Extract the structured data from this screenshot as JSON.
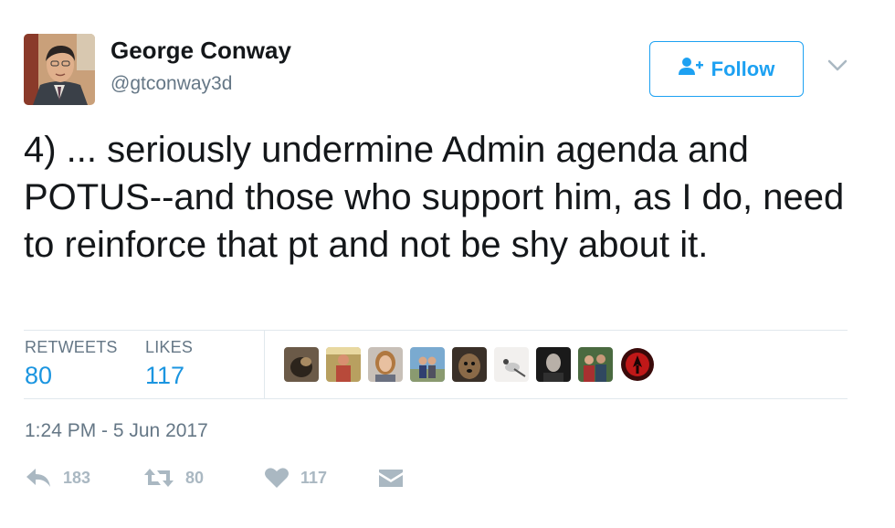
{
  "user": {
    "name": "George Conway",
    "handle": "@gtconway3d",
    "avatar_icon": "user-avatar-portrait"
  },
  "follow_button": {
    "label": "Follow",
    "icon": "follow-person-plus-icon",
    "color": "#1da1f2"
  },
  "menu": {
    "icon": "chevron-down-icon"
  },
  "tweet": {
    "text": "4) ... seriously undermine Admin agenda and POTUS--and those who support him, as I do, need to reinforce that pt and not be shy about it.",
    "timestamp": "1:24 PM - 5 Jun 2017"
  },
  "stats": {
    "retweets_label": "RETWEETS",
    "retweets_value": "80",
    "likes_label": "LIKES",
    "likes_value": "117",
    "accent_color": "#1b95e0"
  },
  "liker_avatars": [
    {
      "icon": "liker-avatar-dog"
    },
    {
      "icon": "liker-avatar-group"
    },
    {
      "icon": "liker-avatar-woman"
    },
    {
      "icon": "liker-avatar-couple"
    },
    {
      "icon": "liker-avatar-dog-portrait"
    },
    {
      "icon": "liker-avatar-bird"
    },
    {
      "icon": "liker-avatar-man-dark"
    },
    {
      "icon": "liker-avatar-family"
    },
    {
      "icon": "liker-avatar-red-logo"
    }
  ],
  "actions": {
    "reply": {
      "icon": "reply-icon",
      "count": "183"
    },
    "retweet": {
      "icon": "retweet-icon",
      "count": "80"
    },
    "like": {
      "icon": "heart-icon",
      "count": "117"
    },
    "message": {
      "icon": "direct-message-icon"
    }
  }
}
